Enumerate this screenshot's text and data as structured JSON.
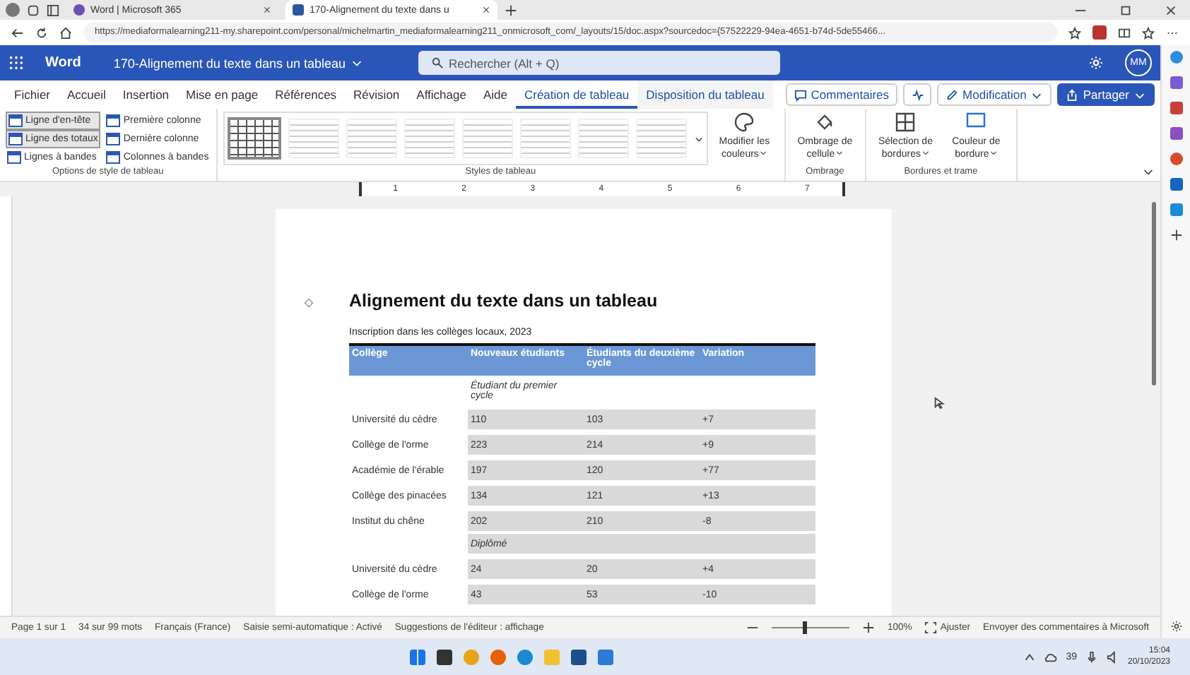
{
  "browser": {
    "tabs": [
      {
        "title": "Word | Microsoft 365",
        "selected": false
      },
      {
        "title": "170-Alignement du texte dans u",
        "selected": true
      }
    ],
    "url": "https://mediaformalearning211-my.sharepoint.com/personal/michelmartin_mediaformalearning211_onmicrosoft_com/_layouts/15/doc.aspx?sourcedoc={57522229-94ea-4651-b74d-5de55466..."
  },
  "app": {
    "name": "Word",
    "doc_title": "170-Alignement du texte dans un tableau",
    "search_placeholder": "Rechercher (Alt + Q)",
    "user_initials": "MM"
  },
  "ribbon_tabs": [
    {
      "label": "Fichier",
      "selected": false
    },
    {
      "label": "Accueil",
      "selected": false
    },
    {
      "label": "Insertion",
      "selected": false
    },
    {
      "label": "Mise en page",
      "selected": false
    },
    {
      "label": "Références",
      "selected": false
    },
    {
      "label": "Révision",
      "selected": false
    },
    {
      "label": "Affichage",
      "selected": false
    },
    {
      "label": "Aide",
      "selected": false
    },
    {
      "label": "Création de tableau",
      "selected": true
    },
    {
      "label": "Disposition du tableau",
      "selected": false
    }
  ],
  "header_buttons": {
    "comments": "Commentaires",
    "mode": "Modification",
    "share": "Partager"
  },
  "style_options": {
    "label": "Options de style de tableau",
    "items": [
      {
        "label": "Ligne d'en-tête",
        "checked": true
      },
      {
        "label": "Ligne des totaux",
        "checked": true
      },
      {
        "label": "Lignes à bandes",
        "checked": false
      },
      {
        "label": "Première colonne",
        "checked": false
      },
      {
        "label": "Dernière colonne",
        "checked": false
      },
      {
        "label": "Colonnes à bandes",
        "checked": false
      }
    ]
  },
  "table_styles": {
    "label": "Styles de tableau",
    "color_button": "Modifier les couleurs"
  },
  "ribbon_groups": [
    {
      "label": "Ombrage",
      "buttons": [
        "Ombrage de cellule"
      ]
    },
    {
      "label": "Bordures et trame",
      "buttons": [
        "Sélection de bordures",
        "Couleur de bordure"
      ]
    }
  ],
  "ruler": [
    "1",
    "2",
    "3",
    "4",
    "5",
    "6",
    "7"
  ],
  "document": {
    "title": "Alignement du texte dans un tableau",
    "caption": "Inscription dans les collèges locaux, 2023",
    "columns": [
      "Collège",
      "Nouveaux étudiants",
      "Étudiants du deuxième cycle",
      "Variation"
    ],
    "rows": [
      {
        "kind": "group",
        "label": "Étudiant du premier cycle",
        "shaded": false
      },
      {
        "kind": "data",
        "cells": [
          "Université du cèdre",
          "110",
          "103",
          "+7"
        ]
      },
      {
        "kind": "data",
        "cells": [
          "Collège de l'orme",
          "223",
          "214",
          "+9"
        ]
      },
      {
        "kind": "data",
        "cells": [
          "Académie de l'érable",
          "197",
          "120",
          "+77"
        ]
      },
      {
        "kind": "data",
        "cells": [
          "Collège des pinacées",
          "134",
          "121",
          "+13"
        ]
      },
      {
        "kind": "data",
        "cells": [
          "Institut du chêne",
          "202",
          "210",
          "-8"
        ]
      },
      {
        "kind": "group",
        "label": "Diplômé",
        "shaded": true
      },
      {
        "kind": "data",
        "cells": [
          "Université du cèdre",
          "24",
          "20",
          "+4"
        ]
      },
      {
        "kind": "data",
        "cells": [
          "Collège de l'orme",
          "43",
          "53",
          "-10"
        ]
      }
    ]
  },
  "status_bar": {
    "items": [
      "Page 1 sur 1",
      "34 sur 99 mots",
      "Français (France)",
      "Saisie semi-automatique : Activé",
      "Suggestions de l'éditeur : affichage"
    ],
    "zoom": {
      "level": 0.4,
      "reading": "100%"
    },
    "fit": "Ajuster",
    "feedback": "Envoyer des commentaires à Microsoft"
  },
  "taskbar": {
    "temperature": "39",
    "time": "15:04",
    "date": "20/10/2023"
  }
}
